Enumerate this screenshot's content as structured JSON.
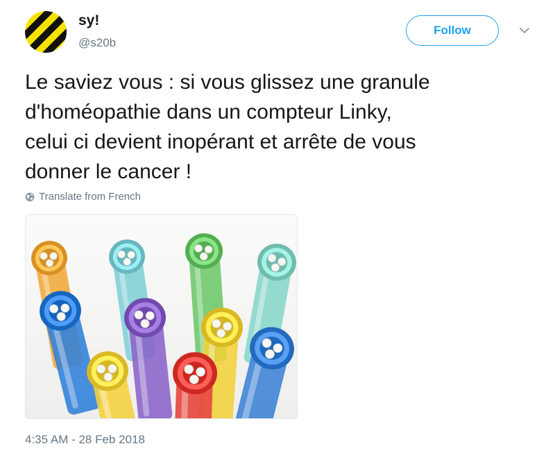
{
  "user": {
    "name": "sy!",
    "handle": "@s20b",
    "avatar_colors": [
      "#111111",
      "#f5e200"
    ]
  },
  "header": {
    "follow_label": "Follow",
    "menu_icon": "chevron-down-icon"
  },
  "tweet": {
    "text": "Le saviez vous : si vous glissez une granule\nd'homéopathie dans un compteur Linky,\ncelui ci devient inopérant et arrête de vous\ndonner le cancer !",
    "translate_label": "Translate from French",
    "translate_icon": "globe-icon",
    "timestamp": "4:35 AM - 28 Feb 2018"
  },
  "media": {
    "tube_colors": [
      "#f2a93b",
      "#7fd0d6",
      "#6cc76a",
      "#88d6c8",
      "#2f7fd9",
      "#8a63c9",
      "#f3d13a",
      "#f4d23f",
      "#e6413a",
      "#3c82d6"
    ]
  },
  "colors": {
    "accent": "#1da1f2",
    "text": "#14171a",
    "muted": "#657786",
    "border": "#e1e8ed"
  }
}
